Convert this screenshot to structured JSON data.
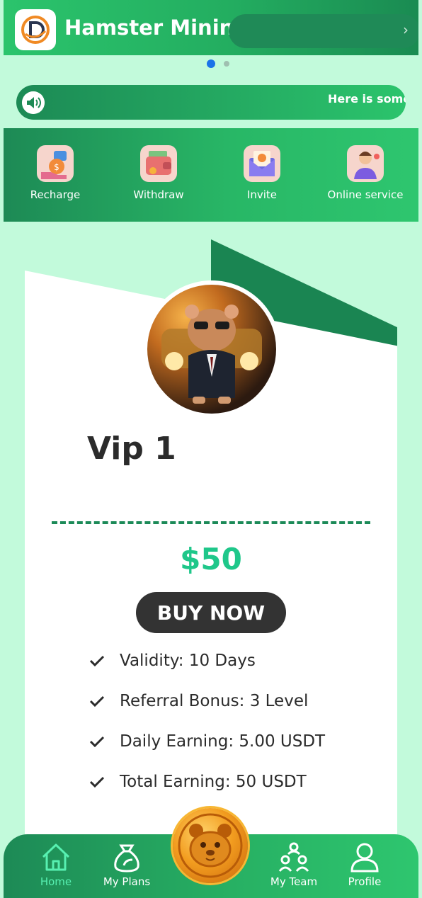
{
  "banner": {
    "title": "Hamster Mining-"
  },
  "carousel": {
    "active_index": 0,
    "count": 2
  },
  "notice": {
    "text": "Here is some"
  },
  "actions": [
    {
      "label": "Recharge",
      "icon": "recharge-icon"
    },
    {
      "label": "Withdraw",
      "icon": "wallet-icon"
    },
    {
      "label": "Invite",
      "icon": "invite-envelope-icon"
    },
    {
      "label": "Online service",
      "icon": "support-agent-icon"
    }
  ],
  "plan": {
    "name": "Vip 1",
    "price": "$50",
    "buy_label": "BUY NOW",
    "features": [
      "Validity: 10 Days",
      "Referral Bonus: 3 Level",
      "Daily Earning: 5.00 USDT",
      "Total Earning: 50 USDT"
    ]
  },
  "nav": {
    "items": [
      {
        "label": "Home",
        "icon": "home-icon",
        "active": true
      },
      {
        "label": "My Plans",
        "icon": "money-bag-icon",
        "active": false
      },
      {
        "label": "My Team",
        "icon": "team-icon",
        "active": false
      },
      {
        "label": "Profile",
        "icon": "profile-icon",
        "active": false
      }
    ],
    "center_icon": "hamster-coin-icon"
  },
  "colors": {
    "accent_green": "#2bc46c",
    "dark_green": "#1a8552",
    "background": "#c2fadb",
    "price": "#1fc78a",
    "active_nav": "#57f0b1"
  }
}
